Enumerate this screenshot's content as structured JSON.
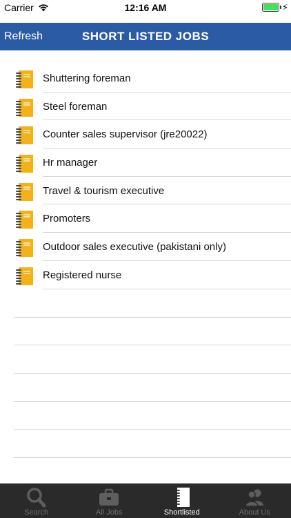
{
  "status_bar": {
    "carrier": "Carrier",
    "time": "12:16 AM",
    "battery_level": 1.0
  },
  "nav": {
    "refresh_label": "Refresh",
    "title": "SHORT LISTED JOBS"
  },
  "jobs": [
    {
      "title": "Shuttering foreman"
    },
    {
      "title": "Steel foreman"
    },
    {
      "title": "Counter sales supervisor (jre20022)"
    },
    {
      "title": "Hr manager"
    },
    {
      "title": "Travel & tourism executive"
    },
    {
      "title": "Promoters"
    },
    {
      "title": "Outdoor sales executive (pakistani only)"
    },
    {
      "title": "Registered nurse"
    }
  ],
  "tabs": [
    {
      "label": "Search",
      "icon": "search-icon",
      "active": false
    },
    {
      "label": "All Jobs",
      "icon": "briefcase-icon",
      "active": false
    },
    {
      "label": "Shortlisted",
      "icon": "notebook-icon",
      "active": true
    },
    {
      "label": "About Us",
      "icon": "people-icon",
      "active": false
    }
  ],
  "colors": {
    "nav_bg": "#2c5ba5",
    "tab_bg": "#2a2a2a",
    "notebook": "#f2b21b",
    "battery": "#4cd964"
  }
}
